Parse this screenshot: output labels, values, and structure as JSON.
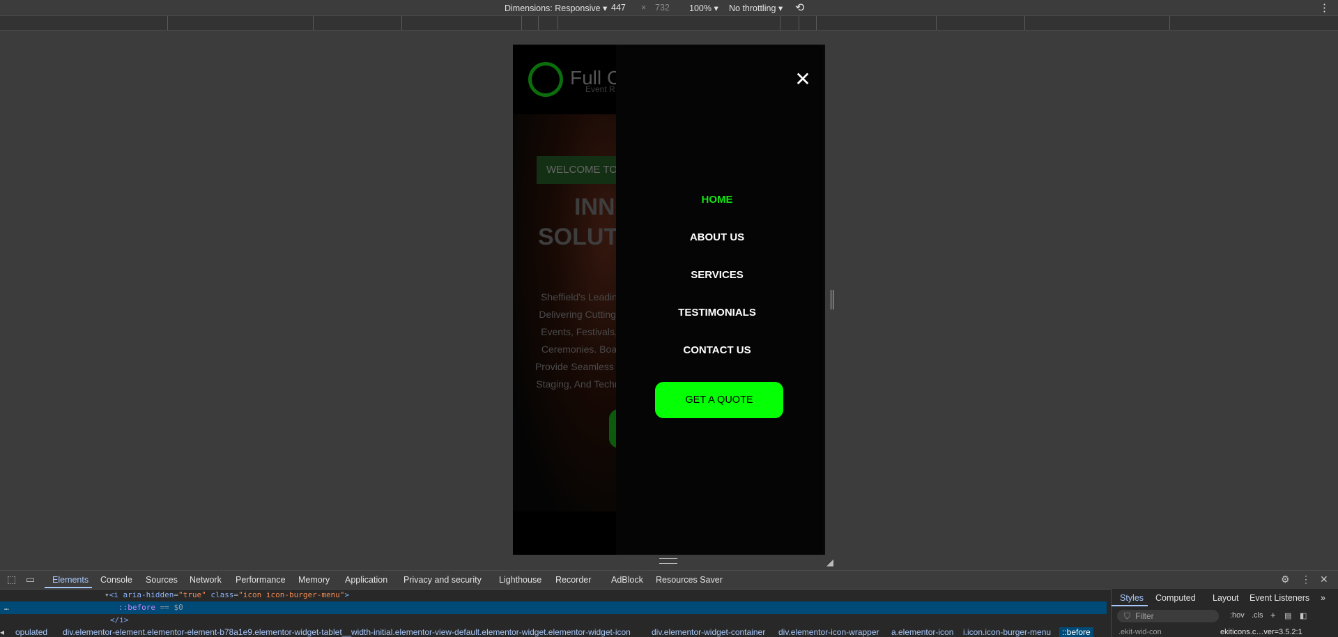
{
  "toolbar": {
    "dimensions_label": "Dimensions: Responsive",
    "width": "447",
    "times": "×",
    "height": "732",
    "zoom": "100%",
    "throttling": "No throttling",
    "caret": "▾",
    "rotate_icon": "⟲",
    "more_icon": "⋮"
  },
  "site": {
    "logo_text": "Full C",
    "logo_sub": "Event R",
    "welcome": "WELCOME TO",
    "headline_1": "INNO",
    "headline_2": "SOLUTION",
    "paragraph": [
      "Sheffield's Leadin",
      "Delivering Cutting-",
      "Events, Festivals,",
      "Ceremonies. Boa",
      "Provide Seamless E",
      "Staging, And Techni"
    ]
  },
  "menu": {
    "close_icon": "✕",
    "items": [
      "HOME",
      "ABOUT US",
      "SERVICES",
      "TESTIMONIALS",
      "CONTACT US"
    ],
    "cta": "GET A QUOTE",
    "accent": "#05ff05"
  },
  "devtools": {
    "tabs": [
      "Elements",
      "Console",
      "Sources",
      "Network",
      "Performance",
      "Memory",
      "Application",
      "Privacy and security",
      "Lighthouse",
      "Recorder",
      "AdBlock",
      "Resources Saver"
    ],
    "code": {
      "l1_open": "<i ",
      "l1_attr1": "aria-hidden",
      "l1_eq1": "=",
      "l1_val1": "\"true\"",
      "l1_attr2": " class",
      "l1_eq2": "=",
      "l1_val2": "\"icon icon-burger-menu\"",
      "l1_close": ">",
      "l2": "::before",
      "l2_eq": "== $0",
      "l3": "</i>"
    },
    "breadcrumbs": [
      "opulated",
      "div.elementor-element.elementor-element-b78a1e9.elementor-widget-tablet__width-initial.elementor-view-default.elementor-widget.elementor-widget-icon",
      "div.elementor-widget-container",
      "div.elementor-icon-wrapper",
      "a.elementor-icon",
      "i.icon.icon-burger-menu",
      "::before"
    ],
    "styles_tabs": [
      "Styles",
      "Computed",
      "Layout",
      "Event Listeners"
    ],
    "filter_placeholder": "Filter",
    "hov": ":hov",
    "cls": ".cls",
    "style_rule": ".ekit-wid-con",
    "style_source": "ekiticons.c…ver=3.5.2:1"
  }
}
